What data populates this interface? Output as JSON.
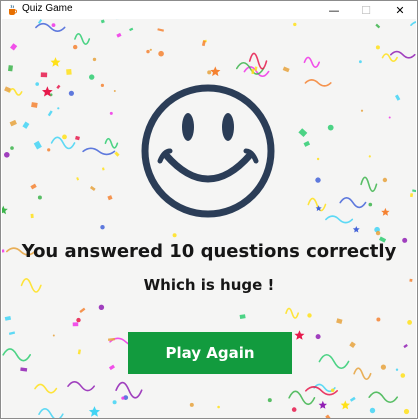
{
  "window": {
    "title": "Quiz Game",
    "controls": {
      "minimize": "—",
      "maximize": "☐",
      "close": "✕"
    }
  },
  "result": {
    "message": "You answered 10 questions correctly",
    "comment": "Which is huge !"
  },
  "actions": {
    "play_again_label": "Play Again",
    "play_again_color": "#129b3e"
  },
  "icons": {
    "app": "java-cup-icon",
    "mascot": "smiley-face-icon",
    "background": "confetti-pattern"
  },
  "colors": {
    "smiley_stroke": "#2b3d57",
    "text": "#161616",
    "background": "#f5f5f4"
  }
}
